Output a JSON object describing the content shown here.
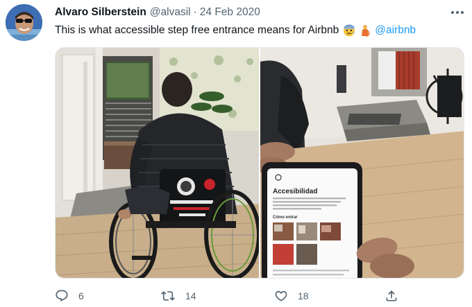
{
  "tweet": {
    "author_name": "Alvaro Silberstein",
    "handle": "@alvasil",
    "separator": "·",
    "date": "24 Feb 2020",
    "text": "This is what accessible step free entrance means for Airbnb",
    "emojis": [
      "anxious-face-with-sweat",
      "person-in-wheelchair"
    ],
    "mention": "@airbnb"
  },
  "media": {
    "count": 2,
    "phone_screen": {
      "heading": "Accesibilidad",
      "section": "Cómo entrar"
    }
  },
  "actions": {
    "reply_count": "6",
    "retweet_count": "14",
    "like_count": "18"
  },
  "colors": {
    "text": "#0f1419",
    "secondary": "#536471",
    "link": "#1d9bf0"
  },
  "icons": [
    "more-icon",
    "reply-icon",
    "retweet-icon",
    "like-icon",
    "share-icon"
  ]
}
